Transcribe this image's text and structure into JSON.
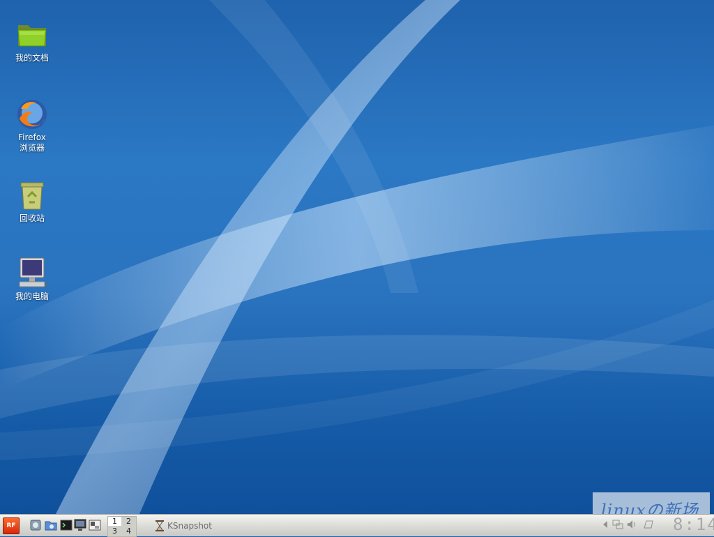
{
  "desktop": {
    "icons": [
      {
        "label_line1": "我的文档",
        "label_line2": "",
        "icon": "folder-icon"
      },
      {
        "label_line1": "Firefox",
        "label_line2": "浏览器",
        "icon": "firefox-icon"
      },
      {
        "label_line1": "回收站",
        "label_line2": "",
        "icon": "trash-icon"
      },
      {
        "label_line1": "我的电脑",
        "label_line2": "",
        "icon": "computer-icon"
      }
    ]
  },
  "taskbar": {
    "start_label": "RF",
    "quick_launch": [
      "home-icon",
      "file-manager-icon",
      "terminal-icon",
      "monitor-icon",
      "desktop-icon"
    ],
    "pager": [
      "1",
      "2",
      "3",
      "4"
    ],
    "tasks": [
      {
        "label": "KSnapshot",
        "icon": "hourglass-icon"
      }
    ],
    "clock": "8:14",
    "tray": [
      "arrow-left-icon",
      "network-icon",
      "volume-icon",
      "battery-icon"
    ]
  },
  "watermark": {
    "text": "linuxの新场"
  },
  "colors": {
    "desktop_blue": "#1f62ad",
    "taskbar_light": "#dcdcd8",
    "start_red": "#d9270b"
  }
}
